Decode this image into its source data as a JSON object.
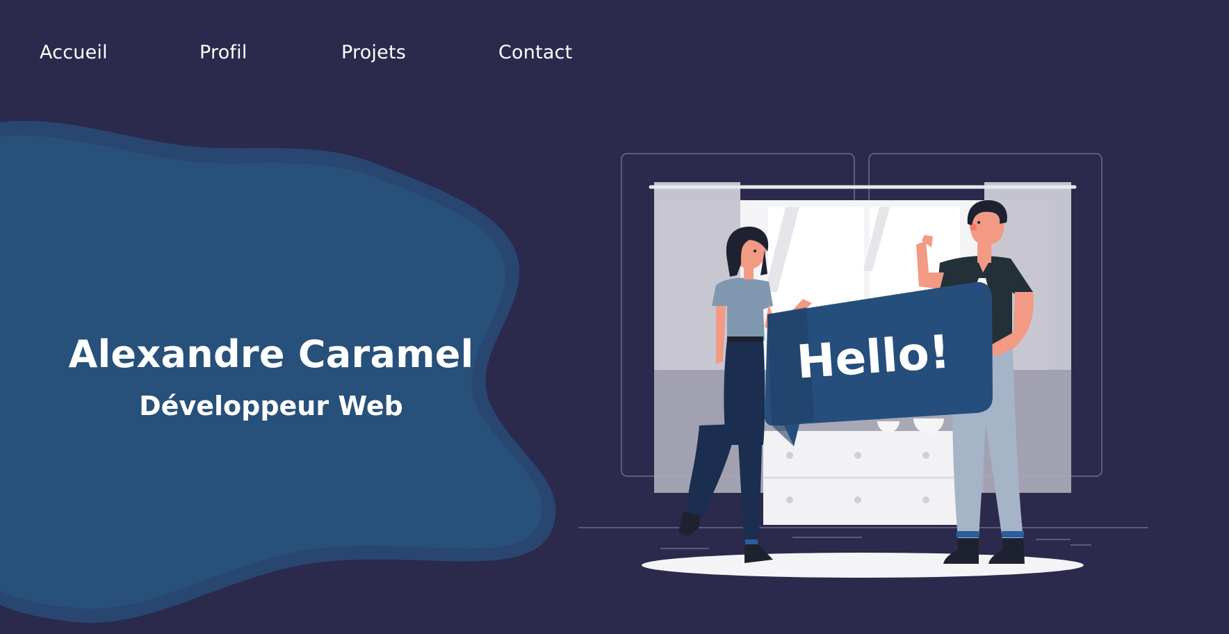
{
  "nav": {
    "items": [
      {
        "label": "Accueil"
      },
      {
        "label": "Profil"
      },
      {
        "label": "Projets"
      },
      {
        "label": "Contact"
      }
    ]
  },
  "hero": {
    "name": "Alexandre Caramel",
    "role": "Développeur Web"
  },
  "illustration": {
    "sign_text": "Hello!"
  },
  "colors": {
    "background": "#2b2a4c",
    "blob": "#27507b",
    "blob_outline": "#284670",
    "sign": "#264e7c"
  }
}
